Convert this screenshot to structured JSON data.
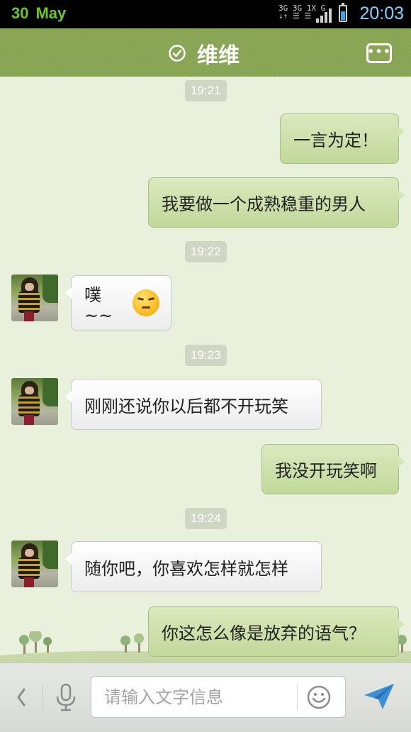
{
  "status_bar": {
    "day": "30",
    "month": "May",
    "network_line1": "3G 3G 1X G",
    "network_line2": "↓↑ ☰ ☰",
    "time": "20:03"
  },
  "header": {
    "title": "维维",
    "accent_color": "#87a552"
  },
  "messages": [
    {
      "type": "timestamp",
      "text": "19:21"
    },
    {
      "type": "outgoing",
      "text": "一言为定！"
    },
    {
      "type": "outgoing",
      "text": "我要做一个成熟稳重的男人"
    },
    {
      "type": "timestamp",
      "text": "19:22"
    },
    {
      "type": "incoming",
      "text": "噗~~",
      "emoji": "smug-face"
    },
    {
      "type": "timestamp",
      "text": "19:23"
    },
    {
      "type": "incoming",
      "text": "刚刚还说你以后都不开玩笑"
    },
    {
      "type": "outgoing",
      "text": "我没开玩笑啊"
    },
    {
      "type": "timestamp",
      "text": "19:24"
    },
    {
      "type": "incoming",
      "text": "随你吧，你喜欢怎样就怎样"
    },
    {
      "type": "outgoing",
      "text": "你这怎么像是放弃的语气？"
    }
  ],
  "input": {
    "placeholder": "请输入文字信息",
    "value": ""
  },
  "icons": {
    "title_status": "check-circle-icon",
    "menu": "more-dots-icon",
    "back": "chevron-left-icon",
    "voice": "microphone-icon",
    "emoji": "smiley-icon",
    "send": "paper-plane-icon"
  }
}
